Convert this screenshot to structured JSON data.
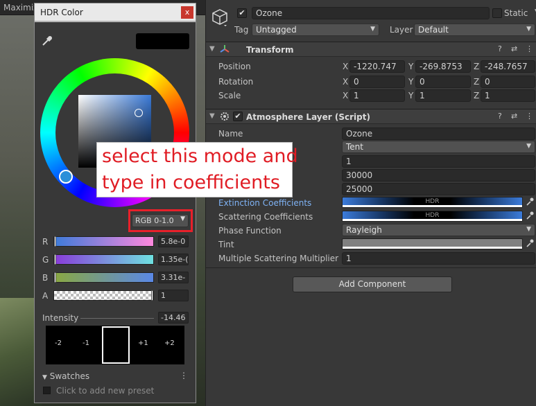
{
  "scene": {
    "maximize_label": "Maximiz"
  },
  "hdr_window": {
    "title": "HDR Color",
    "close_glyph": "x",
    "eyedropper_icon": "eyedropper-icon",
    "preview_color": "#000000",
    "mode": {
      "value": "RGB 0-1.0",
      "caret": "▼"
    },
    "channels": [
      {
        "label": "R",
        "value": "5.8e-0"
      },
      {
        "label": "G",
        "value": "1.35e-("
      },
      {
        "label": "B",
        "value": "3.31e-"
      },
      {
        "label": "A",
        "value": "1"
      }
    ],
    "intensity": {
      "label": "Intensity",
      "value": "-14.46"
    },
    "stops": [
      "-2",
      "-1",
      "+1",
      "+2"
    ],
    "swatches": {
      "label": "Swatches",
      "kebab": "⋮",
      "hint": "Click to add new preset"
    }
  },
  "annotation": {
    "line1": "select this mode and",
    "line2": "type in coefficients"
  },
  "inspector": {
    "object": {
      "name": "Ozone",
      "static_label": "Static",
      "active_check": "✔"
    },
    "tag": {
      "label": "Tag",
      "value": "Untagged"
    },
    "layer": {
      "label": "Layer",
      "value": "Default"
    },
    "transform": {
      "title": "Transform",
      "rows": [
        {
          "label": "Position",
          "x": "-1220.747",
          "y": "-269.8753",
          "z": "-248.7657"
        },
        {
          "label": "Rotation",
          "x": "0",
          "y": "0",
          "z": "0"
        },
        {
          "label": "Scale",
          "x": "1",
          "y": "1",
          "z": "1"
        }
      ],
      "axes": {
        "x": "X",
        "y": "Y",
        "z": "Z"
      }
    },
    "atmosphere": {
      "title": "Atmosphere Layer (Script)",
      "name_label": "Name",
      "name_value": "Ozone",
      "profile_value": "Tent",
      "field1": "1",
      "field2": "30000",
      "field3": "25000",
      "extinction_label": "Extinction Coefficients",
      "scattering_label": "Scattering Coefficients",
      "hdr_tag": "HDR",
      "phase_label": "Phase Function",
      "phase_value": "Rayleigh",
      "tint_label": "Tint",
      "msm_label": "Multiple Scattering Multiplier",
      "msm_value": "1"
    },
    "header_icons": {
      "help": "?",
      "settings": "⇄",
      "more": "⋮",
      "foldout": "▼",
      "checkmark": "✔"
    },
    "add_component": "Add Component"
  },
  "colors": {
    "annotation_red": "#e01c24",
    "link_blue": "#7fb3f5",
    "accent_blue": "#3c7bd9"
  }
}
